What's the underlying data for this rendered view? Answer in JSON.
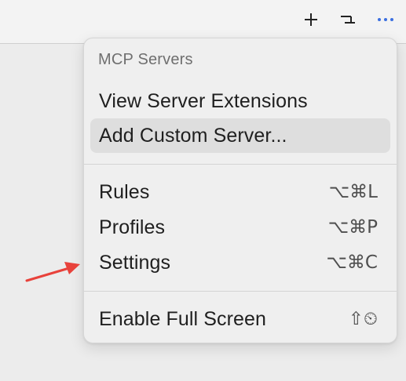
{
  "toolbar": {
    "icons": [
      "plus-icon",
      "list-icon",
      "more-icon"
    ],
    "accent_color": "#3b6fe0"
  },
  "menu": {
    "header": "MCP Servers",
    "items": [
      {
        "label": "View Server Extensions",
        "shortcut": ""
      },
      {
        "label": "Add Custom Server...",
        "shortcut": ""
      },
      {
        "label": "Rules",
        "shortcut": "⌥⌘L"
      },
      {
        "label": "Profiles",
        "shortcut": "⌥⌘P"
      },
      {
        "label": "Settings",
        "shortcut": "⌥⌘C"
      },
      {
        "label": "Enable Full Screen",
        "shortcut": "⇧⏲"
      }
    ]
  },
  "annotation": {
    "arrow_color": "#e8423b"
  }
}
